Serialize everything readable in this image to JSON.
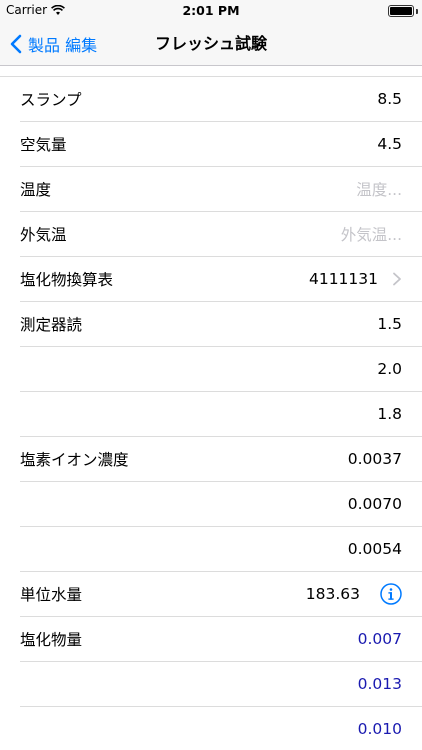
{
  "status": {
    "carrier": "Carrier",
    "time": "2:01 PM"
  },
  "nav": {
    "back_label": "製品 編集",
    "title": "フレッシュ試験"
  },
  "rows": [
    {
      "label": "スランプ",
      "value": "8.5"
    },
    {
      "label": "空気量",
      "value": "4.5"
    },
    {
      "label": "温度",
      "placeholder": "温度..."
    },
    {
      "label": "外気温",
      "placeholder": "外気温..."
    },
    {
      "label": "塩化物換算表",
      "value": "4111131"
    },
    {
      "label": "測定器読",
      "value": "1.5"
    },
    {
      "label": "",
      "value": "2.0"
    },
    {
      "label": "",
      "value": "1.8"
    },
    {
      "label": "塩素イオン濃度",
      "value": "0.0037"
    },
    {
      "label": "",
      "value": "0.0070"
    },
    {
      "label": "",
      "value": "0.0054"
    },
    {
      "label": "単位水量",
      "value": "183.63"
    },
    {
      "label": "塩化物量",
      "value": "0.007"
    },
    {
      "label": "",
      "value": "0.013"
    },
    {
      "label": "",
      "value": "0.010"
    }
  ],
  "colors": {
    "accent": "#007aff",
    "computed_value": "#1a1ab0",
    "placeholder": "#c4c4c9"
  }
}
